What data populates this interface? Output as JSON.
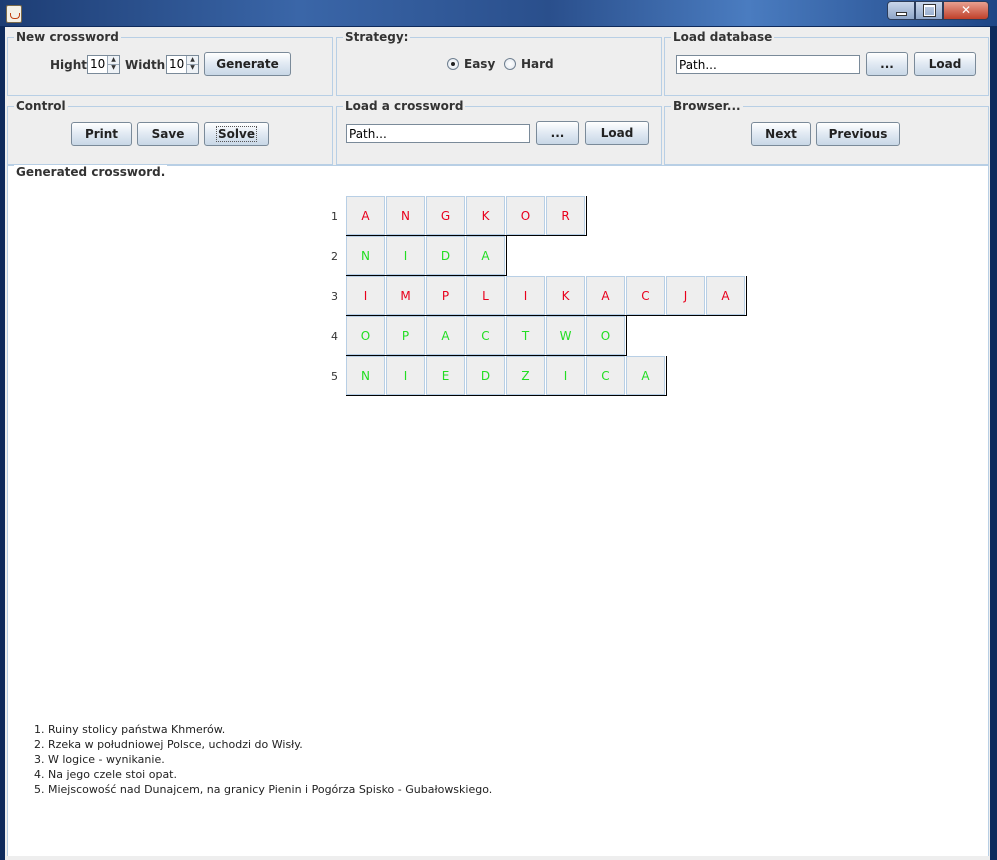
{
  "colors": {
    "red": "#e8001c",
    "green": "#22dd22"
  },
  "window": {
    "icon": "java-cup-icon"
  },
  "new_crossword": {
    "title": "New crossword",
    "hight_label": "Hight",
    "hight_value": "10",
    "width_label": "Width",
    "width_value": "10",
    "generate_label": "Generate"
  },
  "strategy": {
    "title": "Strategy:",
    "options": [
      {
        "label": "Easy",
        "selected": true
      },
      {
        "label": "Hard",
        "selected": false
      }
    ]
  },
  "load_database": {
    "title": "Load database",
    "path_value": "Path...",
    "browse_label": "...",
    "load_label": "Load"
  },
  "control": {
    "title": "Control",
    "print_label": "Print",
    "save_label": "Save",
    "solve_label": "Solve"
  },
  "load_crossword": {
    "title": "Load a crossword",
    "path_value": "Path...",
    "browse_label": "...",
    "load_label": "Load"
  },
  "browser": {
    "title": "Browser...",
    "next_label": "Next",
    "previous_label": "Previous"
  },
  "crossword": {
    "title": "Generated crossword.",
    "rows": [
      {
        "number": "1",
        "color": "red",
        "letters": [
          "A",
          "N",
          "G",
          "K",
          "O",
          "R"
        ]
      },
      {
        "number": "2",
        "color": "green",
        "letters": [
          "N",
          "I",
          "D",
          "A"
        ]
      },
      {
        "number": "3",
        "color": "red",
        "letters": [
          "I",
          "M",
          "P",
          "L",
          "I",
          "K",
          "A",
          "C",
          "J",
          "A"
        ]
      },
      {
        "number": "4",
        "color": "green",
        "letters": [
          "O",
          "P",
          "A",
          "C",
          "T",
          "W",
          "O"
        ]
      },
      {
        "number": "5",
        "color": "green",
        "letters": [
          "N",
          "I",
          "E",
          "D",
          "Z",
          "I",
          "C",
          "A"
        ]
      }
    ],
    "clues": [
      "1. Ruiny stolicy państwa Khmerów.",
      "2. Rzeka w południowej Polsce,  uchodzi do Wisły.",
      "3. W logice - wynikanie.",
      "4. Na jego czele stoi opat.",
      "5. Miejscowość nad Dunajcem, na granicy Pienin i Pogórza Spisko - Gubałowskiego."
    ]
  }
}
